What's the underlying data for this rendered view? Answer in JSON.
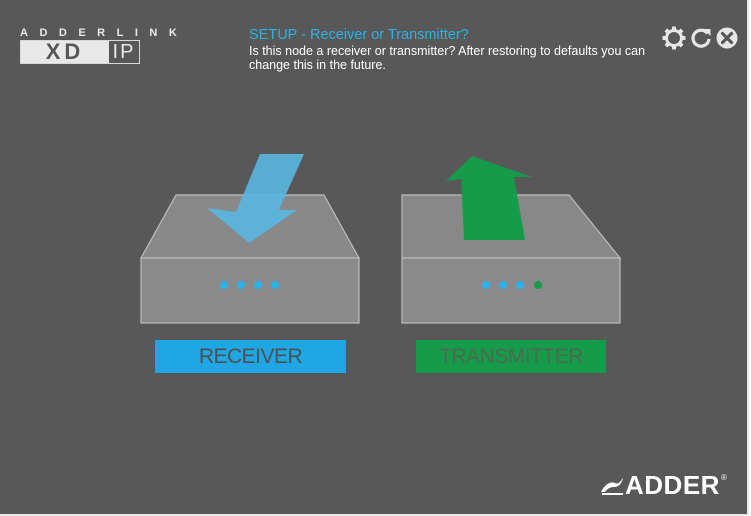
{
  "logo": {
    "letters": "ADDERLINK",
    "xd": "XD",
    "ip": "IP"
  },
  "header": {
    "title": "SETUP - Receiver or Transmitter?",
    "description": "Is this node a receiver or transmitter? After restoring to defaults you can change this in the future."
  },
  "toolbar": {
    "icons": [
      "gear-icon",
      "refresh-icon",
      "close-icon"
    ]
  },
  "choices": {
    "receiver_label": "RECEIVER",
    "transmitter_label": "TRANSMITTER"
  },
  "colors": {
    "background": "#585858",
    "receiver_accent": "#1ea7e4",
    "transmitter_accent": "#169b4b",
    "title_accent": "#2ab3ea"
  },
  "brand": {
    "name": "ADDER",
    "reg": "®"
  }
}
